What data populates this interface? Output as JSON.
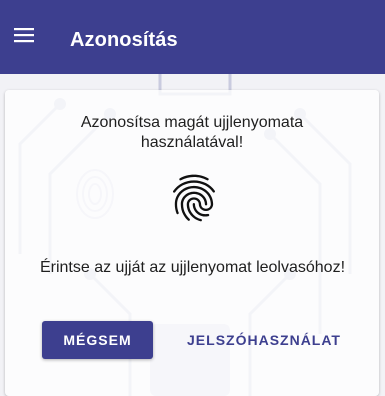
{
  "app_bar": {
    "title": "Azonosítás",
    "menu_icon": "hamburger-menu-icon",
    "color": "#3d3f8f"
  },
  "dialog": {
    "instruction": "Azonosítsa magát ujjlenyomata használatával!",
    "fingerprint_icon": "fingerprint-icon",
    "touch_prompt": "Érintse az ujját az ujjlenyomat leolvasóhoz!",
    "cancel_label": "MÉGSEM",
    "password_label": "JELSZÓHASZNÁLAT",
    "accent_color": "#3d3f8f"
  }
}
